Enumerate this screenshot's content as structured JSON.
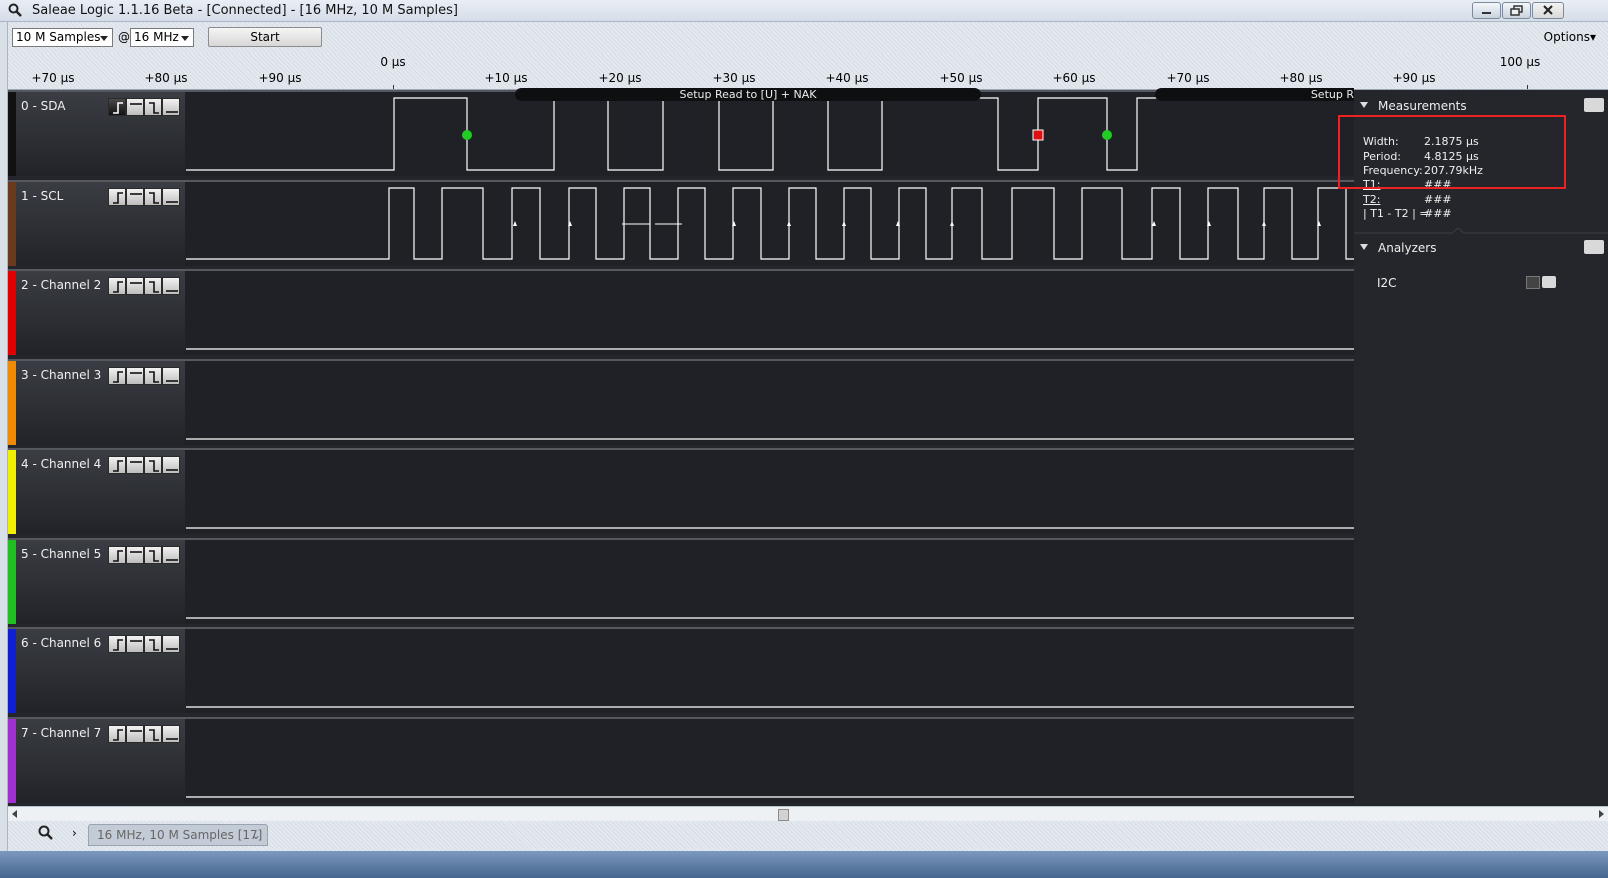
{
  "window": {
    "title": "Saleae Logic 1.1.16 Beta - [Connected] - [16 MHz, 10 M Samples]"
  },
  "toolbar": {
    "samples_value": "10 M Samples",
    "at_label": "@",
    "rate_value": "16 MHz",
    "start_label": "Start",
    "options_label": "Options▾"
  },
  "ruler": {
    "ticks": [
      "+70 µs",
      "+80 µs",
      "+90 µs",
      "0 µs",
      "+10 µs",
      "+20 µs",
      "+30 µs",
      "+40 µs",
      "+50 µs",
      "+60 µs",
      "+70 µs",
      "+80 µs",
      "+90 µs",
      "100 µs"
    ]
  },
  "channels": [
    {
      "name": "0 - SDA",
      "color": "#111111"
    },
    {
      "name": "1 - SCL",
      "color": "#6b3a1e"
    },
    {
      "name": "2 - Channel 2",
      "color": "#e00000"
    },
    {
      "name": "3 - Channel 3",
      "color": "#f08a00"
    },
    {
      "name": "4 - Channel 4",
      "color": "#f0f000"
    },
    {
      "name": "5 - Channel 5",
      "color": "#20c020"
    },
    {
      "name": "6 - Channel 6",
      "color": "#1020d0"
    },
    {
      "name": "7 - Channel 7",
      "color": "#a030d0"
    }
  ],
  "decode": {
    "bubble1": "Setup Read to [U] + NAK",
    "bubble2": "Setup R"
  },
  "measurements": {
    "title": "Measurements",
    "width_label": "Width:",
    "width_value": "2.1875 µs",
    "period_label": "Period:",
    "period_value": "4.8125 µs",
    "frequency_label": "Frequency:",
    "frequency_value": "207.79kHz",
    "t1_label": "T1:",
    "t1_value": "###",
    "t2_label": "T2:",
    "t2_value": "###",
    "diff_label": "| T1 - T2 | =",
    "diff_value": "###"
  },
  "analyzers": {
    "title": "Analyzers",
    "items": [
      "I2C"
    ]
  },
  "bottom": {
    "capture_tab": "16 MHz, 10 M Samples [17]"
  },
  "colors": {
    "trace": "#ffffff",
    "highlight": "#e22222",
    "marker_green": "#22cc22",
    "marker_red": "#dd1111"
  }
}
